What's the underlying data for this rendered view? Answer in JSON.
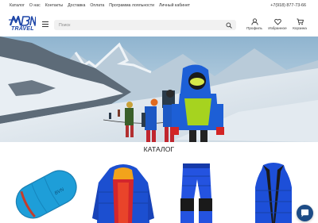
{
  "top_nav": {
    "links": [
      "Каталог",
      "О нас",
      "Контакты",
      "Доставка",
      "Оплата",
      "Программа лояльности",
      "Личный кабинет"
    ],
    "phone": "+7(918) 877-73-66"
  },
  "header": {
    "logo_mark": "BVN",
    "logo_text": "TRAVEL",
    "search_placeholder": "Поиск",
    "profile_label": "Профиль",
    "favorites_label": "Избранное",
    "cart_label": "Корзина"
  },
  "hero": {
    "image": "mountain-climbers-snow-banner"
  },
  "catalog": {
    "title": "КАТАЛОГ",
    "items": [
      {
        "image": "blue-sleeping-bag"
      },
      {
        "image": "blue-red-down-jacket"
      },
      {
        "image": "blue-down-pants"
      },
      {
        "image": "blue-down-vest"
      }
    ]
  },
  "colors": {
    "brand_blue": "#1f47a8",
    "chat_button": "#1d4c86"
  },
  "icons": [
    "menu-icon",
    "search-icon",
    "user-icon",
    "heart-icon",
    "cart-icon",
    "chat-icon"
  ]
}
